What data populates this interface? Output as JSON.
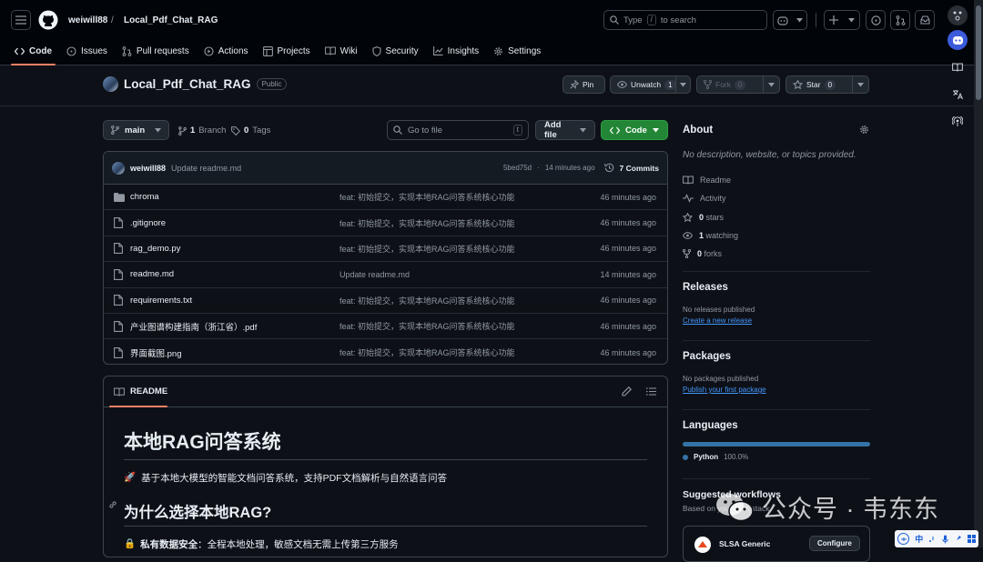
{
  "header": {
    "owner": "weiwill88",
    "separator": "/",
    "repo": "Local_Pdf_Chat_RAG",
    "search_prefix": "Type",
    "search_key": "/",
    "search_suffix": "to search"
  },
  "tabs": [
    {
      "label": "Code",
      "icon": "code-icon"
    },
    {
      "label": "Issues",
      "icon": "issue-icon"
    },
    {
      "label": "Pull requests",
      "icon": "pull-request-icon"
    },
    {
      "label": "Actions",
      "icon": "play-icon"
    },
    {
      "label": "Projects",
      "icon": "table-icon"
    },
    {
      "label": "Wiki",
      "icon": "book-icon"
    },
    {
      "label": "Security",
      "icon": "shield-icon"
    },
    {
      "label": "Insights",
      "icon": "graph-icon"
    },
    {
      "label": "Settings",
      "icon": "gear-icon"
    }
  ],
  "repo": {
    "name": "Local_Pdf_Chat_RAG",
    "visibility": "Public",
    "pin_label": "Pin",
    "watch_label": "Unwatch",
    "watch_count": "1",
    "fork_label": "Fork",
    "fork_count": "0",
    "star_label": "Star",
    "star_count": "0"
  },
  "controls": {
    "branch": "main",
    "branches_count": "1",
    "branches_label": "Branch",
    "tags_count": "0",
    "tags_label": "Tags",
    "goto_placeholder": "Go to file",
    "goto_key": "t",
    "add_file": "Add file",
    "code": "Code"
  },
  "commit": {
    "author": "weiwill88",
    "message": "Update readme.md",
    "hash": "5bed75d",
    "sep": "·",
    "time": "14 minutes ago",
    "commits_count": "7",
    "commits_label": "Commits"
  },
  "files": [
    {
      "type": "folder",
      "name": "chroma",
      "message": "feat: 初始提交，实现本地RAG问答系统核心功能",
      "time": "46 minutes ago"
    },
    {
      "type": "file",
      "name": ".gitignore",
      "message": "feat: 初始提交，实现本地RAG问答系统核心功能",
      "time": "46 minutes ago"
    },
    {
      "type": "file",
      "name": "rag_demo.py",
      "message": "feat: 初始提交，实现本地RAG问答系统核心功能",
      "time": "46 minutes ago"
    },
    {
      "type": "file",
      "name": "readme.md",
      "message": "Update readme.md",
      "time": "14 minutes ago"
    },
    {
      "type": "file",
      "name": "requirements.txt",
      "message": "feat: 初始提交，实现本地RAG问答系统核心功能",
      "time": "46 minutes ago"
    },
    {
      "type": "file",
      "name": "产业图谱构建指南（浙江省）.pdf",
      "message": "feat: 初始提交，实现本地RAG问答系统核心功能",
      "time": "46 minutes ago"
    },
    {
      "type": "file",
      "name": "界面截图.png",
      "message": "feat: 初始提交，实现本地RAG问答系统核心功能",
      "time": "46 minutes ago"
    }
  ],
  "readme": {
    "tab_label": "README",
    "title": "本地RAG问答系统",
    "intro_emoji": "🚀",
    "intro": "基于本地大模型的智能文档问答系统，支持PDF文档解析与自然语言问答",
    "section": "为什么选择本地RAG?",
    "bullet_emoji": "🔒",
    "bullet_bold": "私有数据安全",
    "bullet_text": "：全程本地处理，敏感文档无需上传第三方服务"
  },
  "about": {
    "heading": "About",
    "description": "No description, website, or topics provided.",
    "items": [
      {
        "icon": "book-icon",
        "bold": "",
        "label": "Readme"
      },
      {
        "icon": "pulse-icon",
        "bold": "",
        "label": "Activity"
      },
      {
        "icon": "star-icon",
        "bold": "0",
        "label": "stars"
      },
      {
        "icon": "eye-icon",
        "bold": "1",
        "label": "watching"
      },
      {
        "icon": "fork-icon",
        "bold": "0",
        "label": "forks"
      }
    ]
  },
  "releases": {
    "heading": "Releases",
    "text": "No releases published",
    "link": "Create a new release"
  },
  "packages": {
    "heading": "Packages",
    "text": "No packages published",
    "link": "Publish your first package"
  },
  "languages": {
    "heading": "Languages",
    "items": [
      {
        "name": "Python",
        "percent": "100.0%",
        "share": 1.0,
        "color": "#3572A5"
      }
    ]
  },
  "workflows": {
    "heading": "Suggested workflows",
    "subtext": "Based on your tech stack",
    "card_title": "SLSA Generic",
    "card_button": "Configure"
  },
  "watermark": {
    "text": "公众号 · 韦东东"
  },
  "ime": {
    "mode": "中"
  },
  "colors": {
    "accent_green": "#238636",
    "link_blue": "#4493f8",
    "tab_underline": "#f78166"
  }
}
